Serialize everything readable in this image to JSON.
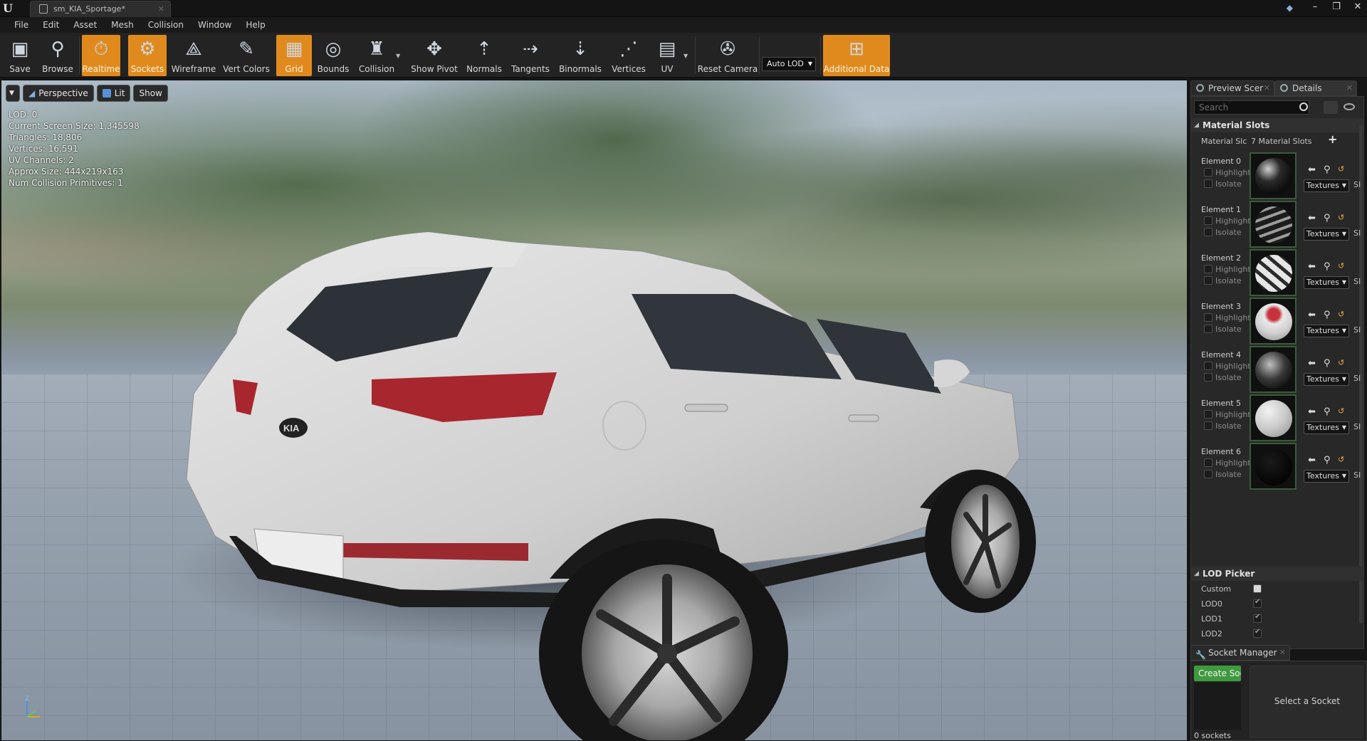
{
  "app": {
    "tab_title": "sm_KIA_Sportage*"
  },
  "menu": [
    "File",
    "Edit",
    "Asset",
    "Mesh",
    "Collision",
    "Window",
    "Help"
  ],
  "toolbar": {
    "save": "Save",
    "browse": "Browse",
    "realtime": "Realtime",
    "sockets": "Sockets",
    "wireframe": "Wireframe",
    "vert_colors": "Vert Colors",
    "grid": "Grid",
    "bounds": "Bounds",
    "collision": "Collision",
    "show_pivot": "Show Pivot",
    "normals": "Normals",
    "tangents": "Tangents",
    "binormals": "Binormals",
    "vertices": "Vertices",
    "uv": "UV",
    "reset_camera": "Reset Camera",
    "auto_lod": "Auto LOD",
    "additional_data": "Additional Data",
    "accent_color": "#e08a1e"
  },
  "viewport": {
    "perspective": "Perspective",
    "lit": "Lit",
    "show": "Show",
    "stats": [
      "LOD:  0",
      "Current Screen Size:  1.345598",
      "Triangles:  18,806",
      "Vertices:  16,591",
      "UV Channels:  2",
      "Approx Size: 444x219x163",
      "Num Collision Primitives:  1"
    ],
    "axis_z": "Z"
  },
  "right_panel": {
    "tab_preview": "Preview Scer",
    "tab_details": "Details",
    "search_placeholder": "Search",
    "material_slots_header": "Material Slots",
    "material_slots_label": "Material Slc",
    "material_slots_count": "7 Material Slots",
    "highlight": "Highlight",
    "isolate": "Isolate",
    "textures": "Textures",
    "si": "SI",
    "elements": [
      "Element 0",
      "Element 1",
      "Element 2",
      "Element 3",
      "Element 4",
      "Element 5",
      "Element 6"
    ],
    "lod_picker_header": "LOD Picker",
    "lod_rows": [
      "Custom",
      "LOD0",
      "LOD1",
      "LOD2"
    ]
  },
  "socket_manager": {
    "tab": "Socket Manager",
    "create": "Create Socket",
    "count": "0 sockets",
    "select": "Select a Socket",
    "create_color": "#3f9a3f"
  }
}
